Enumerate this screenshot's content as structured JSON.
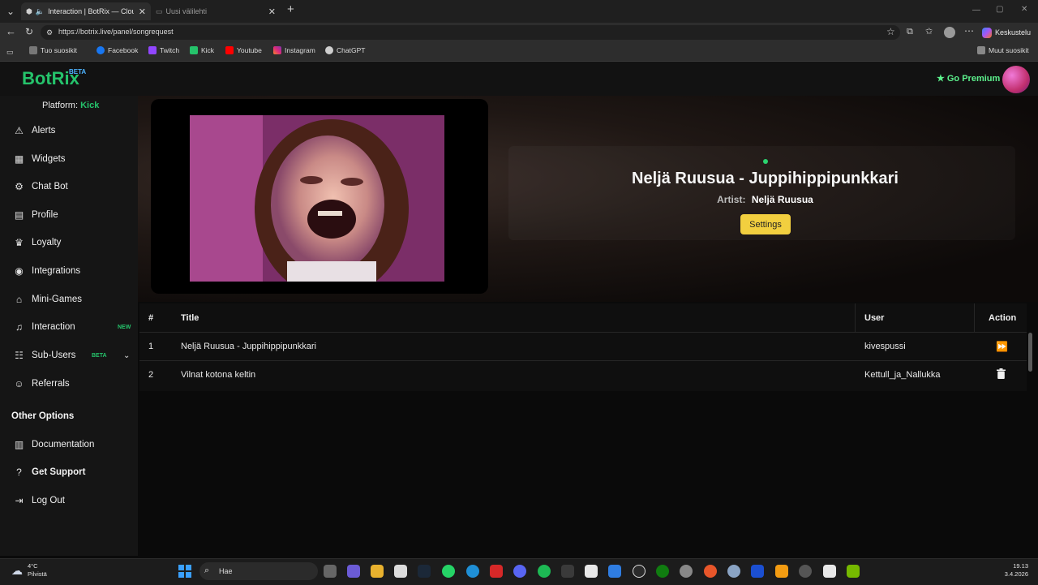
{
  "browser": {
    "tabs": [
      {
        "title": "Interaction | BotRix — Cloud",
        "active": true
      },
      {
        "title": "Uusi välilehti",
        "active": false
      }
    ],
    "url": "https://botrix.live/panel/songrequest",
    "profile_button": "Keskustelu",
    "bookmarks": [
      {
        "label": "Tuo suosikit",
        "icon": "import-icon"
      },
      {
        "label": "Facebook",
        "icon": "facebook-icon"
      },
      {
        "label": "Twitch",
        "icon": "twitch-icon"
      },
      {
        "label": "Kick",
        "icon": "kick-icon"
      },
      {
        "label": "Youtube",
        "icon": "youtube-icon"
      },
      {
        "label": "Instagram",
        "icon": "instagram-icon"
      },
      {
        "label": "ChatGPT",
        "icon": "chatgpt-icon"
      }
    ],
    "other_bookmarks": "Muut suosikit"
  },
  "app": {
    "logo": "BotRix",
    "logo_badge": "BETA",
    "premium_label": "Go Premium",
    "platform_label": "Platform:",
    "platform_value": "Kick",
    "nav": [
      {
        "label": "Alerts",
        "icon": "warning-icon"
      },
      {
        "label": "Widgets",
        "icon": "widgets-icon"
      },
      {
        "label": "Chat Bot",
        "icon": "robot-icon"
      },
      {
        "label": "Profile",
        "icon": "id-card-icon"
      },
      {
        "label": "Loyalty",
        "icon": "trophy-icon"
      },
      {
        "label": "Integrations",
        "icon": "discord-icon"
      },
      {
        "label": "Mini-Games",
        "icon": "gamepad-icon"
      },
      {
        "label": "Interaction",
        "icon": "music-icon",
        "badge": "NEW"
      },
      {
        "label": "Sub-Users",
        "icon": "users-icon",
        "badge": "BETA"
      },
      {
        "label": "Referrals",
        "icon": "user-group-icon"
      }
    ],
    "other_options_title": "Other Options",
    "other_options": [
      {
        "label": "Documentation",
        "icon": "book-icon"
      },
      {
        "label": "Get Support",
        "icon": "question-icon"
      },
      {
        "label": "Log Out",
        "icon": "logout-icon"
      }
    ]
  },
  "now_playing": {
    "title": "Neljä Ruusua - Juppihippipunkkari",
    "artist_label": "Artist:",
    "artist": "Neljä Ruusua",
    "settings_label": "Settings"
  },
  "queue": {
    "headers": {
      "num": "#",
      "title": "Title",
      "user": "User",
      "action": "Action"
    },
    "rows": [
      {
        "num": "1",
        "title": "Neljä Ruusua - Juppihippipunkkari",
        "user": "kivespussi",
        "action_icon": "skip-forward-icon"
      },
      {
        "num": "2",
        "title": "Vilnat kotona keltin",
        "user": "Kettull_ja_Nallukka",
        "action_icon": "trash-icon"
      }
    ]
  },
  "taskbar": {
    "weather_temp": "4°C",
    "weather_desc": "Pilvistä",
    "search_placeholder": "Hae",
    "time": "19.13",
    "date": "3.4.2026"
  }
}
